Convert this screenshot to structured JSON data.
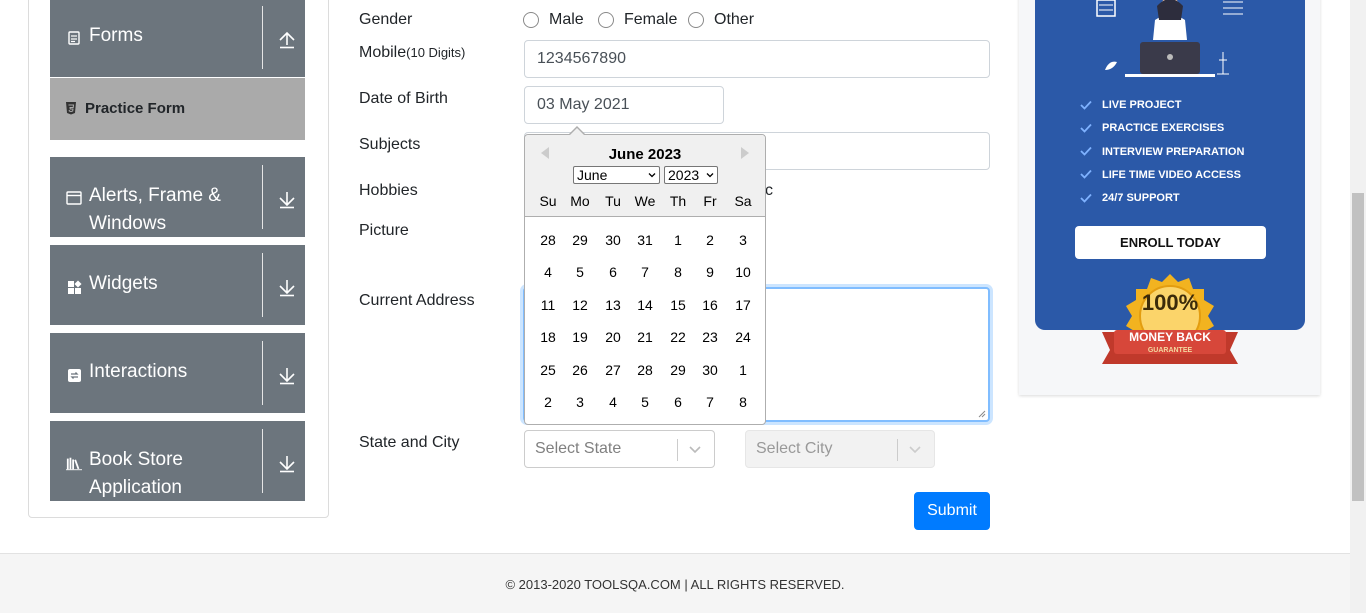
{
  "sidebar": {
    "groups": [
      {
        "label": "Forms",
        "icon": "document-icon",
        "arrow": "up"
      },
      {
        "label": "Alerts, Frame &",
        "label2": "Windows",
        "icon": "window-icon",
        "arrow": "down"
      },
      {
        "label": "Widgets",
        "icon": "widgets-icon",
        "arrow": "down"
      },
      {
        "label": "Interactions",
        "icon": "interactions-icon",
        "arrow": "down"
      },
      {
        "label": "Book Store",
        "label2": "Application",
        "icon": "books-icon",
        "arrow": "down"
      }
    ],
    "active_item": "Practice Form"
  },
  "form": {
    "gender_label": "Gender",
    "gender_options": [
      "Male",
      "Female",
      "Other"
    ],
    "mobile_label": "Mobile",
    "mobile_hint": "(10 Digits)",
    "mobile_value": "1234567890",
    "dob_label": "Date of Birth",
    "dob_value": "03 May 2021",
    "subjects_label": "Subjects",
    "hobbies_label": "Hobbies",
    "hobbies_fragment": "c",
    "picture_label": "Picture",
    "address_label": "Current Address",
    "state_city_label": "State and City",
    "state_placeholder": "Select State",
    "city_placeholder": "Select City",
    "submit_label": "Submit"
  },
  "datepicker": {
    "title": "June 2023",
    "month_select": "June",
    "year_select": "2023",
    "day_names": [
      "Su",
      "Mo",
      "Tu",
      "We",
      "Th",
      "Fr",
      "Sa"
    ],
    "weeks": [
      [
        "28",
        "29",
        "30",
        "31",
        "1",
        "2",
        "3"
      ],
      [
        "4",
        "5",
        "6",
        "7",
        "8",
        "9",
        "10"
      ],
      [
        "11",
        "12",
        "13",
        "14",
        "15",
        "16",
        "17"
      ],
      [
        "18",
        "19",
        "20",
        "21",
        "22",
        "23",
        "24"
      ],
      [
        "25",
        "26",
        "27",
        "28",
        "29",
        "30",
        "1"
      ],
      [
        "2",
        "3",
        "4",
        "5",
        "6",
        "7",
        "8"
      ]
    ]
  },
  "ad": {
    "items": [
      "LIVE PROJECT",
      "PRACTICE EXERCISES",
      "INTERVIEW PREPARATION",
      "LIFE TIME VIDEO ACCESS",
      "24/7 SUPPORT"
    ],
    "enroll_label": "ENROLL TODAY",
    "badge_big": "100%",
    "badge_ribbon": "MONEY BACK",
    "badge_small": "GUARANTEE"
  },
  "footer": {
    "text": "© 2013-2020 TOOLSQA.COM | ALL RIGHTS RESERVED."
  },
  "colors": {
    "sidebar_bg": "#6c757d",
    "active_bg": "#aaaaaa",
    "primary": "#007bff",
    "ad_blue": "#2b59a8"
  }
}
